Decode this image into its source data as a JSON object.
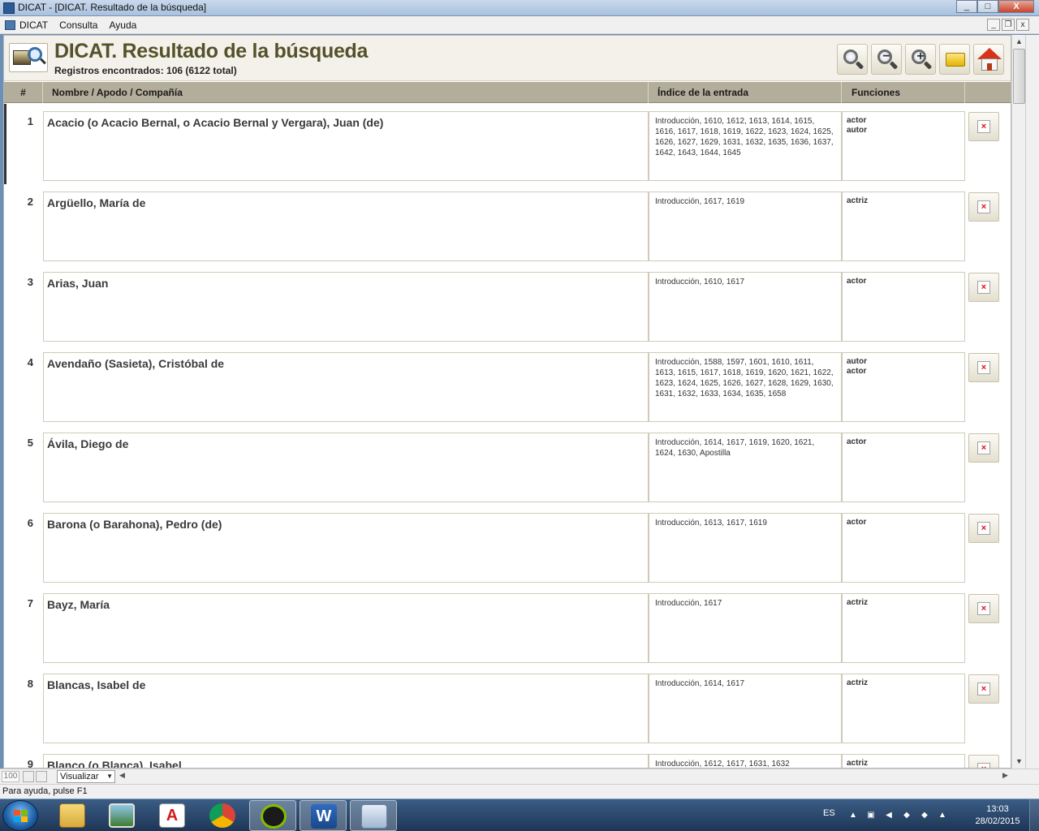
{
  "window": {
    "title": "DICAT - [DICAT. Resultado de la búsqueda]",
    "minimize": "_",
    "maximize": "□",
    "close": "X"
  },
  "menu": {
    "items": [
      "DICAT",
      "Consulta",
      "Ayuda"
    ],
    "mdi_minimize": "_",
    "mdi_restore": "❐",
    "mdi_close": "x"
  },
  "header": {
    "title": "DICAT. Resultado de la búsqueda",
    "subtitle": "Registros encontrados: 106 (6122 total)"
  },
  "toolbar": {
    "buttons": [
      "search-icon",
      "zoom-out-icon",
      "zoom-in-icon",
      "folder-icon",
      "home-icon"
    ]
  },
  "columns": {
    "num": "#",
    "name": "Nombre / Apodo / Compañía",
    "index": "Índice de la entrada",
    "functions": "Funciones"
  },
  "rows": [
    {
      "num": "1",
      "name": "Acacio (o Acacio Bernal, o Acacio Bernal y Vergara), Juan (de)",
      "index": "Introducción, 1610, 1612, 1613, 1614, 1615, 1616, 1617, 1618, 1619, 1622, 1623, 1624, 1625, 1626, 1627, 1629, 1631, 1632, 1635, 1636, 1637, 1642, 1643, 1644, 1645",
      "functions": [
        "actor",
        "autor"
      ]
    },
    {
      "num": "2",
      "name": "Argüello, María de",
      "index": "Introducción, 1617, 1619",
      "functions": [
        "actriz"
      ]
    },
    {
      "num": "3",
      "name": "Arias, Juan",
      "index": "Introducción, 1610, 1617",
      "functions": [
        "actor"
      ]
    },
    {
      "num": "4",
      "name": "Avendaño (Sasieta), Cristóbal de",
      "index": "Introducción, 1588, 1597, 1601, 1610, 1611, 1613, 1615, 1617, 1618, 1619, 1620, 1621, 1622, 1623, 1624, 1625, 1626, 1627, 1628, 1629, 1630, 1631, 1632, 1633, 1634, 1635, 1658",
      "functions": [
        "autor",
        "actor"
      ]
    },
    {
      "num": "5",
      "name": "Ávila, Diego de",
      "index": "Introducción, 1614, 1617, 1619, 1620, 1621, 1624, 1630, Apostilla",
      "functions": [
        "actor"
      ]
    },
    {
      "num": "6",
      "name": "Barona (o Barahona), Pedro (de)",
      "index": "Introducción, 1613, 1617, 1619",
      "functions": [
        "actor"
      ]
    },
    {
      "num": "7",
      "name": "Bayz, María",
      "index": "Introducción, 1617",
      "functions": [
        "actriz"
      ]
    },
    {
      "num": "8",
      "name": "Blancas, Isabel de",
      "index": "Introducción, 1614, 1617",
      "functions": [
        "actriz"
      ]
    },
    {
      "num": "9",
      "name": "Blanco (o Blanca), Isabel",
      "index": "Introducción, 1612, 1617, 1631, 1632",
      "functions": [
        "actriz"
      ]
    }
  ],
  "bottom": {
    "zoom": "100",
    "view_select": "Visualizar"
  },
  "status": {
    "text": "Para ayuda, pulse F1"
  },
  "taskbar": {
    "apps": [
      "explorer-icon",
      "photos-icon",
      "acrobat-icon",
      "chrome-icon",
      "spotify-icon",
      "word-icon",
      "media-player-icon"
    ],
    "language": "ES",
    "time": "13:03",
    "date": "28/02/2015"
  },
  "colors": {
    "title_text": "#55512a",
    "column_header_bg": "#b3ae9b",
    "taskbar_bg": "#1d3656"
  }
}
